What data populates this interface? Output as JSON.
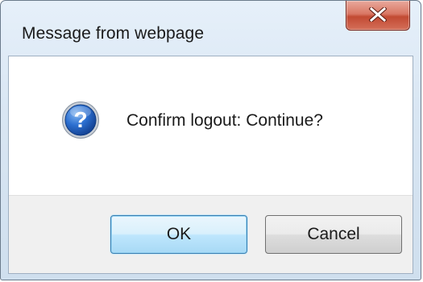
{
  "dialog": {
    "title": "Message from webpage",
    "message": "Confirm logout: Continue?",
    "icon": "question-icon",
    "close_icon": "close-icon",
    "buttons": {
      "ok_label": "OK",
      "cancel_label": "Cancel"
    }
  },
  "colors": {
    "close_button": "#c24a33",
    "default_button_border": "#3c7fb1",
    "icon_blue": "#1f5fb8"
  }
}
